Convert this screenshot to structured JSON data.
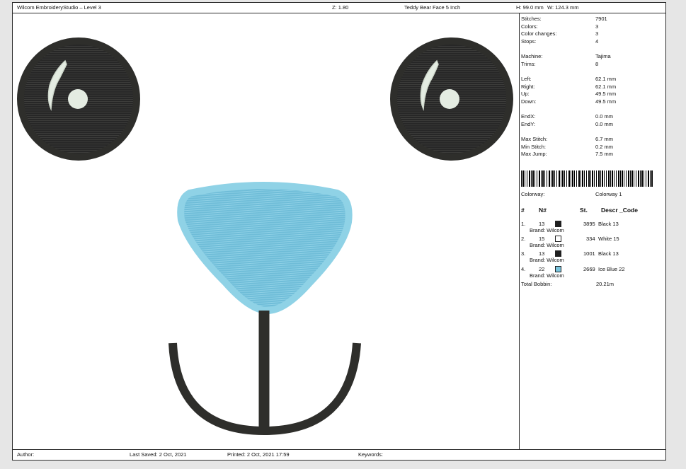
{
  "header": {
    "app_title": "Wilcom EmbroideryStudio – Level 3",
    "zoom": "Z: 1.80",
    "design_name": "Teddy Bear Face 5 Inch",
    "height": "H: 99.0 mm",
    "width": "W: 124.3 mm"
  },
  "stats": {
    "stitches_label": "Stitches:",
    "stitches": "7901",
    "colors_label": "Colors:",
    "colors": "3",
    "color_changes_label": "Color changes:",
    "color_changes": "3",
    "stops_label": "Stops:",
    "stops": "4",
    "machine_label": "Machine:",
    "machine": "Tajima",
    "trims_label": "Trims:",
    "trims": "8",
    "left_label": "Left:",
    "left": "62.1 mm",
    "right_label": "Right:",
    "right": "62.1 mm",
    "up_label": "Up:",
    "up": "49.5 mm",
    "down_label": "Down:",
    "down": "49.5 mm",
    "endx_label": "EndX:",
    "endx": "0.0 mm",
    "endy_label": "EndY:",
    "endy": "0.0 mm",
    "max_stitch_label": "Max Stitch:",
    "max_stitch": "6.7 mm",
    "min_stitch_label": "Min Stitch:",
    "min_stitch": "0.2 mm",
    "max_jump_label": "Max Jump:",
    "max_jump": "7.5 mm"
  },
  "colorway": {
    "label": "Colorway:",
    "value": "Colorway 1"
  },
  "thread_table": {
    "headers": {
      "index": "#",
      "number": "N#",
      "stitches": "St.",
      "descr": "Descr _Code"
    },
    "rows": [
      {
        "index": "1.",
        "number": "13",
        "color": "#1e1e1e",
        "stitches": "3895",
        "descr": "Black 13",
        "brand": "Brand: Wilcom"
      },
      {
        "index": "2.",
        "number": "15",
        "color": "#ffffff",
        "stitches": "334",
        "descr": "White 15",
        "brand": "Brand: Wilcom"
      },
      {
        "index": "3.",
        "number": "13",
        "color": "#1e1e1e",
        "stitches": "1001",
        "descr": "Black 13",
        "brand": "Brand: Wilcom"
      },
      {
        "index": "4.",
        "number": "22",
        "color": "#79c4dd",
        "stitches": "2669",
        "descr": "Ice Blue 22",
        "brand": "Brand: Wilcom"
      }
    ],
    "total_bobbin_label": "Total Bobbin:",
    "total_bobbin": "20.21m"
  },
  "footer": {
    "author": "Author:",
    "last_saved": "Last Saved:  2 Oct, 2021",
    "printed": "Printed:  2 Oct, 2021 17:59",
    "keywords": "Keywords:"
  },
  "icons": {
    "barcode": "barcode-icon",
    "design": [
      "left-eye-icon",
      "right-eye-icon",
      "nose-icon",
      "mouth-icon"
    ]
  },
  "palette": {
    "thread_black": "#2e2e2b",
    "thread_white": "#e4ece2",
    "thread_ice_blue": "#79c4dd",
    "thread_ice_blue_outline": "#8fd2e6"
  }
}
